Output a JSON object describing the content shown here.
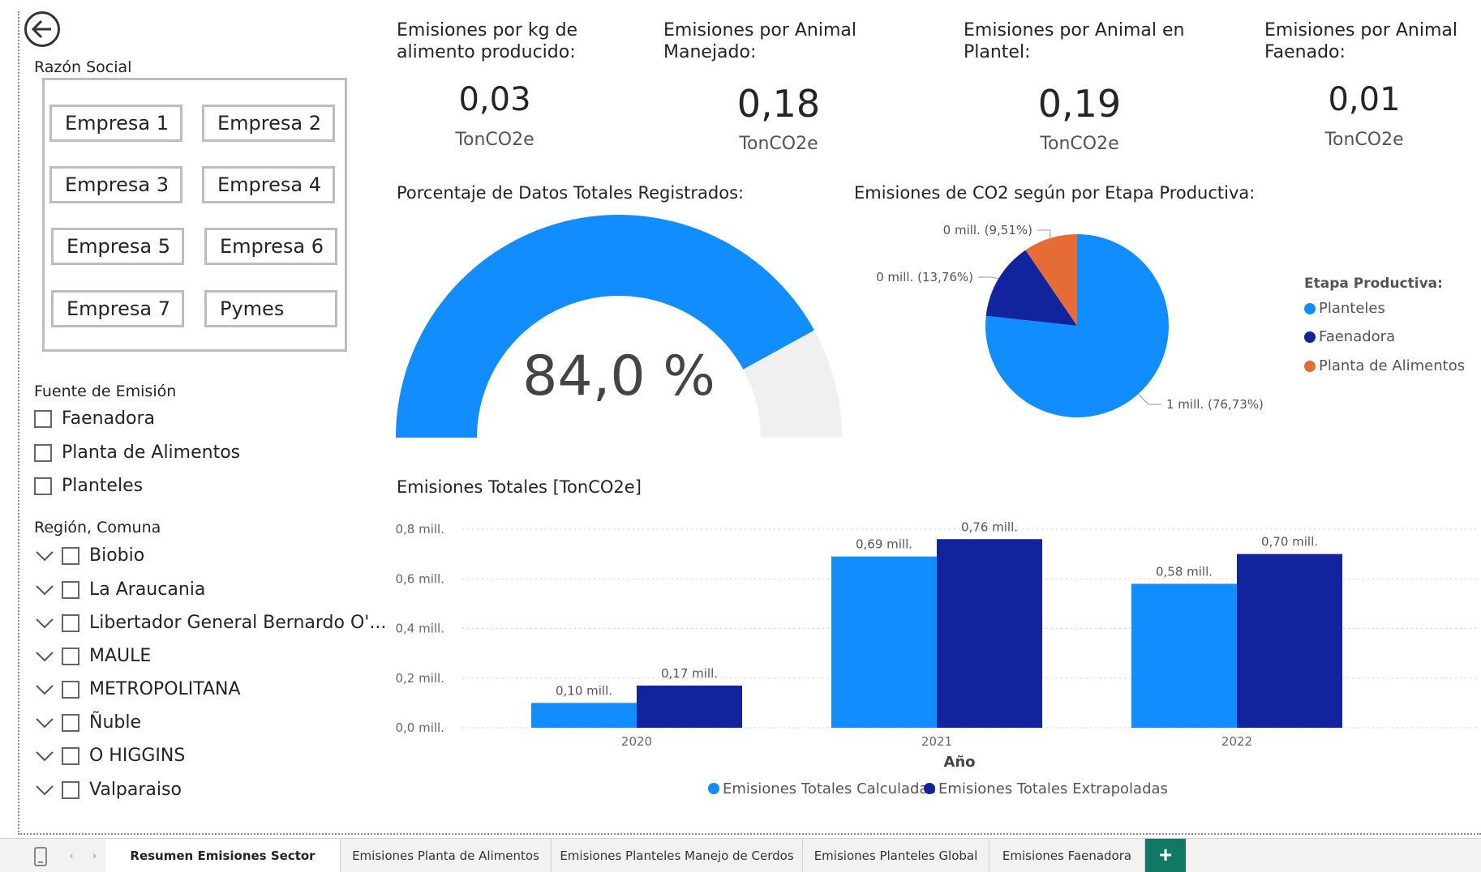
{
  "slicer_razon": {
    "label": "Razón Social",
    "tiles": [
      "Empresa 1",
      "Empresa 2",
      "Empresa 3",
      "Empresa 4",
      "Empresa 5",
      "Empresa 6",
      "Empresa 7",
      "Pymes"
    ]
  },
  "slicer_fuente": {
    "label": "Fuente de Emisión",
    "items": [
      "Faenadora",
      "Planta de Alimentos",
      "Planteles"
    ]
  },
  "slicer_region": {
    "label": "Región, Comuna",
    "items": [
      "Biobio",
      "La Araucania",
      "Libertador General Bernardo O'...",
      "MAULE",
      "METROPOLITANA",
      "Ñuble",
      "O HIGGINS",
      "Valparaiso"
    ]
  },
  "kpis": [
    {
      "title_l1": "Emisiones por kg de",
      "title_l2": "alimento producido:",
      "value": "0,03",
      "unit": "TonCO2e"
    },
    {
      "title_l1": "Emisiones por Animal",
      "title_l2": "Manejado:",
      "value": "0,18",
      "unit": "TonCO2e"
    },
    {
      "title_l1": "Emisiones por Animal en",
      "title_l2": "Plantel:",
      "value": "0,19",
      "unit": "TonCO2e"
    },
    {
      "title_l1": "Emisiones por Animal",
      "title_l2": "Faenado:",
      "value": "0,01",
      "unit": "TonCO2e"
    }
  ],
  "gauge": {
    "title": "Porcentaje de Datos Totales Registrados:",
    "display": "84,0 %",
    "fraction": 0.84,
    "fill_color": "#118DFF",
    "track_color": "#F0F0F0"
  },
  "pie": {
    "title": "Emisiones de CO2 según por Etapa Productiva:",
    "legend_title": "Etapa Productiva:",
    "slices": [
      {
        "name": "Planteles",
        "percent": 76.73,
        "label": "1 mill. (76,73%)",
        "color": "#118DFF"
      },
      {
        "name": "Faenadora",
        "percent": 13.76,
        "label": "0 mill. (13,76%)",
        "color": "#12239E"
      },
      {
        "name": "Planta de Alimentos",
        "percent": 9.51,
        "label": "0 mill. (9,51%)",
        "color": "#E66C37"
      }
    ]
  },
  "chart_data": {
    "type": "bar",
    "title": "Emisiones Totales [TonCO2e]",
    "xlabel": "Año",
    "ylabel": "",
    "categories": [
      "2020",
      "2021",
      "2022"
    ],
    "ylim": [
      0,
      0.8
    ],
    "yticks": [
      "0,0 mill.",
      "0,2 mill.",
      "0,4 mill.",
      "0,6 mill.",
      "0,8 mill."
    ],
    "series": [
      {
        "name": "Emisiones Totales Calculadas",
        "values": [
          0.1,
          0.69,
          0.58
        ],
        "labels": [
          "0,10 mill.",
          "0,69 mill.",
          "0,58 mill."
        ],
        "color": "#118DFF"
      },
      {
        "name": "Emisiones Totales Extrapoladas",
        "values": [
          0.17,
          0.76,
          0.7
        ],
        "labels": [
          "0,17 mill.",
          "0,76 mill.",
          "0,70 mill."
        ],
        "color": "#12239E"
      }
    ]
  },
  "tabs": [
    {
      "label": "Resumen Emisiones Sector Porcino",
      "active": true
    },
    {
      "label": "Emisiones Planta de Alimentos",
      "active": false
    },
    {
      "label": "Emisiones Planteles Manejo de Cerdos",
      "active": false
    },
    {
      "label": "Emisiones Planteles Global",
      "active": false
    },
    {
      "label": "Emisiones Faenadora",
      "active": false
    }
  ],
  "tab_add_label": "+"
}
